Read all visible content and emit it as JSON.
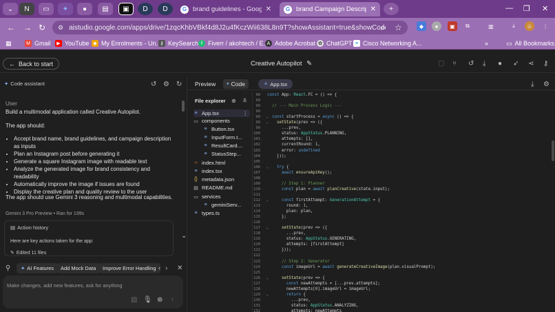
{
  "browser": {
    "tabs": [
      {
        "label": "brand guidelines - Google Sear"
      },
      {
        "label": "brand Campaign Description fo"
      }
    ],
    "pinned": [
      "N",
      "D",
      "D"
    ],
    "url": "aistudio.google.com/apps/drive/1zqcKhbVBkf4d8J2u4fKczWii638L8n9T?showAssistant=true&showCode=true",
    "bookmarks": [
      "Gmail",
      "YouTube",
      "My Enrolments - Un...",
      "KeySearch",
      "Fiverr / akohtech / E...",
      "Adobe Acrobat",
      "ChatGPT",
      "Cisco Networking A..."
    ],
    "all_bookmarks": "All Bookmarks",
    "colors": {
      "tabstrip": "#6e3b8a",
      "toolbar": "#9b6fb3"
    }
  },
  "app": {
    "back_label": "Back to start",
    "title": "Creative Autopilot",
    "preview_tab": "Preview",
    "code_tab": "Code",
    "file_tab": "App.tsx"
  },
  "assistant": {
    "header": "Code assistant",
    "user_label": "User",
    "intro": "Build a multimodal application called Creative Autopilot.",
    "should_label": "The app should:",
    "bullets": [
      "Accept brand name, brand guidelines, and campaign description as inputs",
      "Plan an Instagram post before generating it",
      "Generate a square Instagram image with readable text",
      "Analyze the generated image for brand consistency and readability",
      "Automatically improve the image if issues are found",
      "Display the creative plan and quality review to the user"
    ],
    "outro": "The app should use Gemini 3 reasoning and multimodal capabilities.",
    "model_meta": "Gemini 3 Pro Preview  •  Ran for 199s",
    "action_history": "Action history",
    "actions_text": "Here are key actions taken for the app:",
    "edited": "Edited 11 files",
    "chips": [
      "AI Features",
      "Add Mock Data",
      "Improve Error Handling"
    ],
    "prompt_placeholder": "Make changes, add new features, ask for anything"
  },
  "explorer": {
    "title": "File explorer",
    "items": [
      "App.tsx",
      "components",
      "Button.tsx",
      "InputForm.t...",
      "ResultCard....",
      "StatusStep...",
      "index.html",
      "index.tsx",
      "metadata.json",
      "README.md",
      "services",
      "geminiServ...",
      "types.ts"
    ]
  },
  "editor": {
    "lines": [
      {
        "n": "98",
        "t": "const App: React.FC = () => {"
      },
      {
        "n": "99",
        "t": ""
      },
      {
        "n": "99",
        "t": "  // --- Main Process Logic ---"
      },
      {
        "n": "99",
        "t": ""
      },
      {
        "n": "99",
        "t": "  const startProcess = async () => {"
      },
      {
        "n": "99",
        "t": "    setState(prev => ({"
      },
      {
        "n": "99",
        "t": "      ...prev,"
      },
      {
        "n": "100",
        "t": "      status: AppStatus.PLANNING,"
      },
      {
        "n": "101",
        "t": "      attempts: [],"
      },
      {
        "n": "102",
        "t": "      currentRound: 1,"
      },
      {
        "n": "103",
        "t": "      error: undefined"
      },
      {
        "n": "104",
        "t": "    }));"
      },
      {
        "n": "105",
        "t": ""
      },
      {
        "n": "106",
        "t": "    try {"
      },
      {
        "n": "107",
        "t": "      await ensureApiKey();"
      },
      {
        "n": "108",
        "t": ""
      },
      {
        "n": "109",
        "t": "      // Step 1: Planner"
      },
      {
        "n": "110",
        "t": "      const plan = await planCreative(state.input);"
      },
      {
        "n": "111",
        "t": ""
      },
      {
        "n": "112",
        "t": "      const firstAttempt: GenerationAttempt = {"
      },
      {
        "n": "113",
        "t": "        round: 1,"
      },
      {
        "n": "114",
        "t": "        plan: plan,"
      },
      {
        "n": "115",
        "t": "      };"
      },
      {
        "n": "116",
        "t": ""
      },
      {
        "n": "117",
        "t": "      setState(prev => ({"
      },
      {
        "n": "118",
        "t": "        ...prev,"
      },
      {
        "n": "119",
        "t": "        status: AppStatus.GENERATING,"
      },
      {
        "n": "120",
        "t": "        attempts: [firstAttempt]"
      },
      {
        "n": "121",
        "t": "      }));"
      },
      {
        "n": "122",
        "t": ""
      },
      {
        "n": "123",
        "t": "      // Step 2: Generator"
      },
      {
        "n": "124",
        "t": "      const imageUrl = await generateCreativeImage(plan.visualPrompt);"
      },
      {
        "n": "125",
        "t": ""
      },
      {
        "n": "126",
        "t": "      setState(prev => {"
      },
      {
        "n": "127",
        "t": "        const newAttempts = [...prev.attempts];"
      },
      {
        "n": "128",
        "t": "        newAttempts[0].imageUrl = imageUrl;"
      },
      {
        "n": "129",
        "t": "        return {"
      },
      {
        "n": "130",
        "t": "          ...prev,"
      },
      {
        "n": "131",
        "t": "          status: AppStatus.ANALYZING,"
      },
      {
        "n": "132",
        "t": "          attempts: newAttempts"
      }
    ]
  }
}
